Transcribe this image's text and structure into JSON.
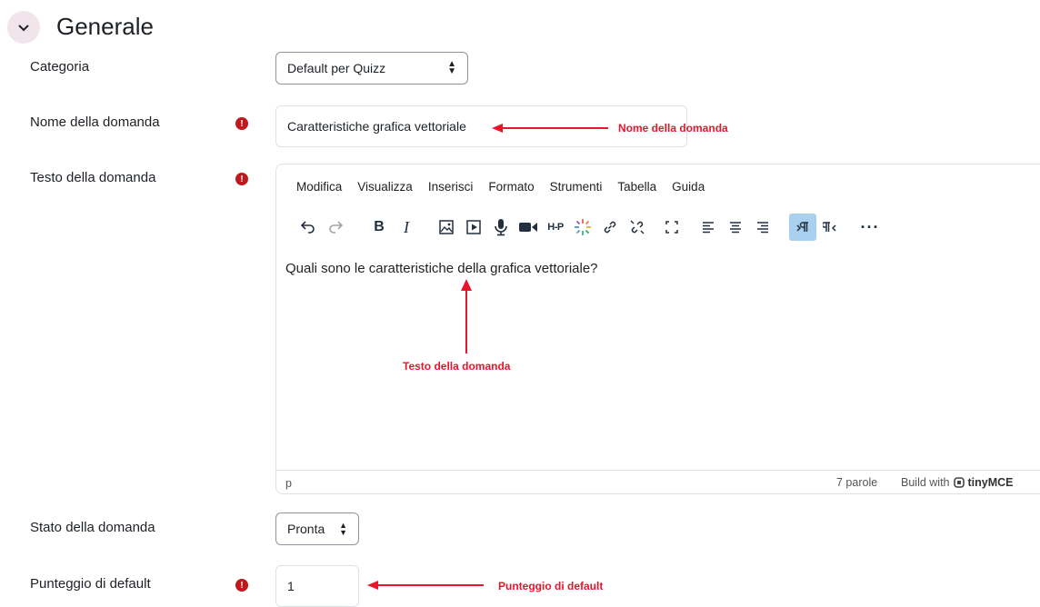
{
  "section": {
    "title": "Generale"
  },
  "fields": {
    "category": {
      "label": "Categoria",
      "value": "Default per Quizz"
    },
    "name": {
      "label": "Nome della domanda",
      "value": "Caratteristiche grafica vettoriale"
    },
    "text": {
      "label": "Testo della domanda"
    },
    "status": {
      "label": "Stato della domanda",
      "value": "Pronta"
    },
    "score": {
      "label": "Punteggio di default",
      "value": "1"
    }
  },
  "required_mark": "!",
  "editor": {
    "menu": [
      "Modifica",
      "Visualizza",
      "Inserisci",
      "Formato",
      "Strumenti",
      "Tabella",
      "Guida"
    ],
    "content": "Quali sono le caratteristiche della grafica vettoriale?",
    "status_path": "p",
    "word_count": "7 parole",
    "build_with": "Build with",
    "brand": "tinyMCE"
  },
  "toolbar": {
    "bold": "B",
    "italic": "I",
    "h5p": "H-P"
  },
  "annotations": {
    "name": "Nome della domanda",
    "text": "Testo della domanda",
    "score": "Punteggio di default"
  },
  "colors": {
    "annotation": "#e8162c",
    "required": "#c0191d",
    "toggle_bg": "#f1e4ea"
  }
}
